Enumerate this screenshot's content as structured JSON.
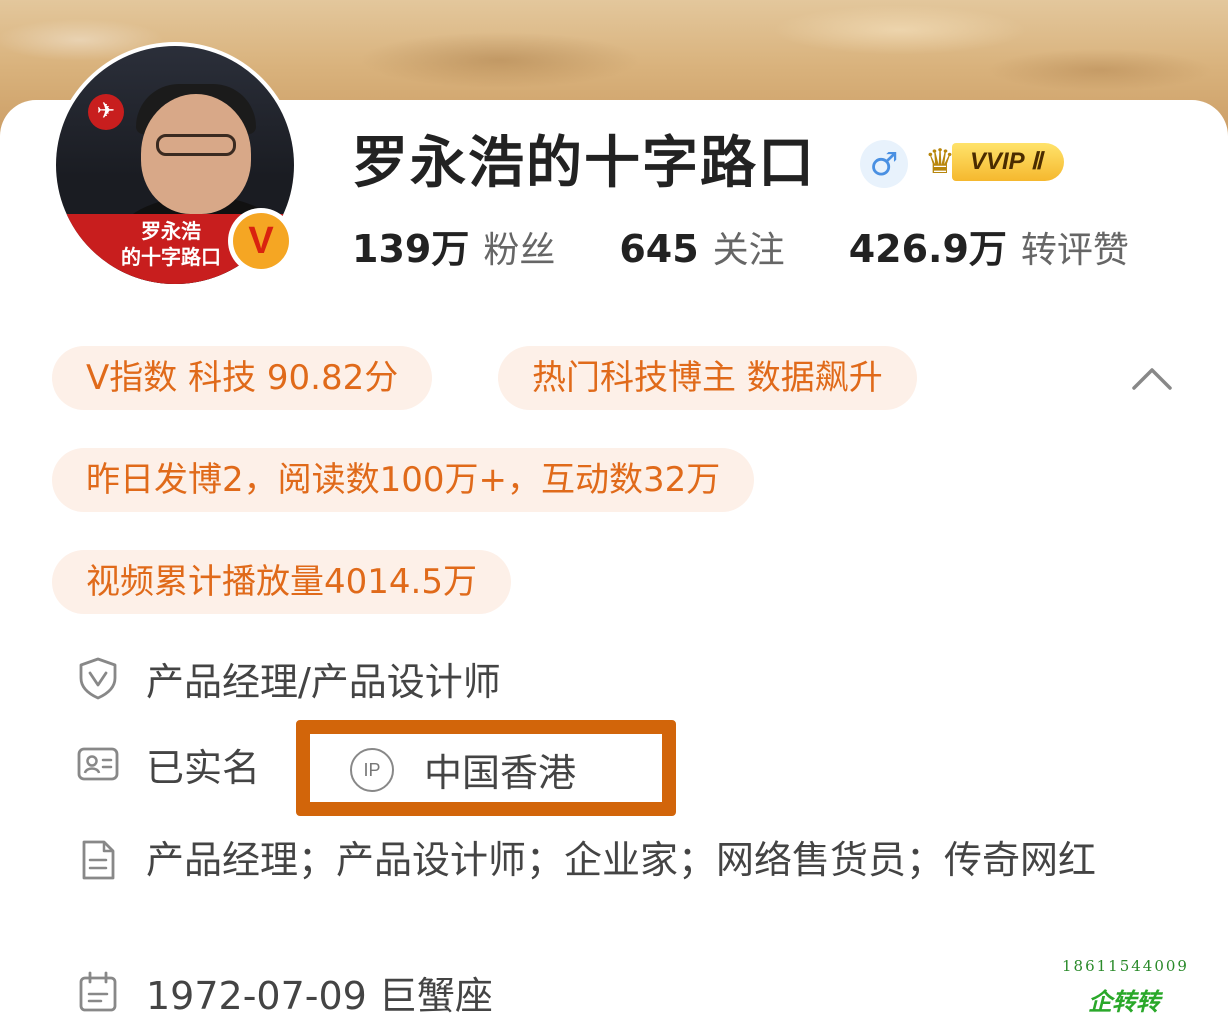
{
  "profile": {
    "name": "罗永浩的十字路口",
    "avatar_caption": "罗永浩\n的十字路口",
    "verified_badge": "V",
    "gender_symbol": "♂",
    "vip_label": "VVIP Ⅱ",
    "stats": [
      {
        "value": "139万",
        "label": "粉丝"
      },
      {
        "value": "645",
        "label": "关注"
      },
      {
        "value": "426.9万",
        "label": "转评赞"
      }
    ]
  },
  "tags": {
    "v_index": "V指数 科技 90.82分",
    "hot": "热门科技博主 数据飙升",
    "yesterday": "昨日发博2，阅读数100万+，互动数32万",
    "video": "视频累计播放量4014.5万"
  },
  "info": {
    "occupation": "产品经理/产品设计师",
    "real_name": "已实名",
    "ip_icon_text": "IP",
    "ip_location": "中国香港",
    "bio": "产品经理；产品设计师；企业家；网络售货员；传奇网红",
    "birthday": "1972-07-09 巨蟹座"
  },
  "watermark": {
    "phone": "18611544009",
    "brand": "企转转"
  },
  "colors": {
    "tag_bg": "#fdf0e8",
    "tag_text": "#e06a1a",
    "highlight_box": "#d2650a",
    "vip_gold": "#f5b82e",
    "gender_blue": "#4a90e2"
  },
  "icons": {
    "occupation": "shield-v-icon",
    "real_name": "id-card-icon",
    "ip": "ip-icon",
    "bio": "document-icon",
    "birthday": "calendar-icon",
    "collapse": "chevron-up-icon",
    "gender": "male-icon",
    "vip": "crown-icon"
  }
}
